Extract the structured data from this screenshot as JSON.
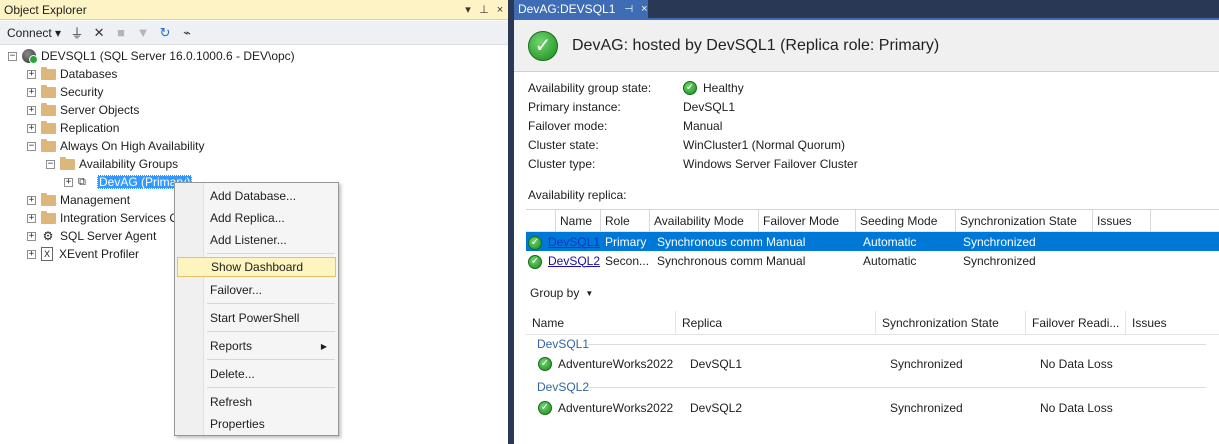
{
  "object_explorer": {
    "title": "Object Explorer",
    "title_controls": [
      "▾",
      "⊥",
      "×"
    ],
    "toolbar": {
      "connect_label": "Connect ▾",
      "icons": [
        "plug-icon",
        "disconnect-icon",
        "stop-icon",
        "filter-icon",
        "refresh-icon",
        "activity-icon"
      ]
    },
    "tree": {
      "server": "DEVSQL1 (SQL Server 16.0.1000.6 - DEV\\opc)",
      "databases": "Databases",
      "security": "Security",
      "server_objects": "Server Objects",
      "replication": "Replication",
      "always_on": "Always On High Availability",
      "availability_groups": "Availability Groups",
      "devag": "DevAG (Primary)",
      "management": "Management",
      "integration_services": "Integration Services Catalogs",
      "sql_agent": "SQL Server Agent",
      "xevent": "XEvent Profiler"
    },
    "context_menu": {
      "add_database": "Add Database...",
      "add_replica": "Add Replica...",
      "add_listener": "Add Listener...",
      "show_dashboard": "Show Dashboard",
      "failover": "Failover...",
      "start_powershell": "Start PowerShell",
      "reports": "Reports",
      "delete": "Delete...",
      "refresh": "Refresh",
      "properties": "Properties"
    }
  },
  "dashboard": {
    "tab_label": "DevAG:DEVSQL1",
    "tab_pin": "⊣",
    "tab_close": "×",
    "header_title": "DevAG: hosted by DevSQL1 (Replica role: Primary)",
    "props": {
      "ag_state_label": "Availability group state:",
      "ag_state_value": "Healthy",
      "primary_label": "Primary instance:",
      "primary_value": "DevSQL1",
      "failover_mode_label": "Failover mode:",
      "failover_mode_value": "Manual",
      "cluster_state_label": "Cluster state:",
      "cluster_state_value": "WinCluster1 (Normal Quorum)",
      "cluster_type_label": "Cluster type:",
      "cluster_type_value": "Windows Server Failover Cluster"
    },
    "replica_section_label": "Availability replica:",
    "replica_columns": {
      "name": "Name",
      "role": "Role",
      "availability_mode": "Availability Mode",
      "failover_mode": "Failover Mode",
      "seeding_mode": "Seeding Mode",
      "sync_state": "Synchronization State",
      "issues": "Issues"
    },
    "replicas": [
      {
        "name": "DevSQL1",
        "role": "Primary",
        "availability_mode": "Synchronous commit",
        "failover_mode": "Manual",
        "seeding_mode": "Automatic",
        "sync_state": "Synchronized"
      },
      {
        "name": "DevSQL2",
        "role": "Secon...",
        "availability_mode": "Synchronous commit",
        "failover_mode": "Manual",
        "seeding_mode": "Automatic",
        "sync_state": "Synchronized"
      }
    ],
    "group_by_label": "Group by",
    "db_columns": {
      "name": "Name",
      "replica": "Replica",
      "sync_state": "Synchronization State",
      "failover_readiness": "Failover Readi...",
      "issues": "Issues"
    },
    "groups": [
      {
        "label": "DevSQL1",
        "db": "AdventureWorks2022",
        "replica": "DevSQL1",
        "sync_state": "Synchronized",
        "failover_readiness": "No Data Loss"
      },
      {
        "label": "DevSQL2",
        "db": "AdventureWorks2022",
        "replica": "DevSQL2",
        "sync_state": "Synchronized",
        "failover_readiness": "No Data Loss"
      }
    ]
  }
}
